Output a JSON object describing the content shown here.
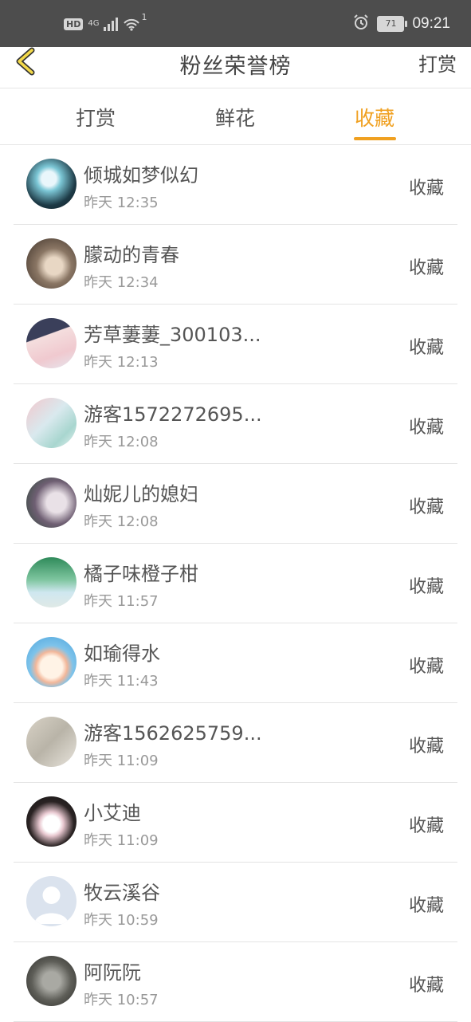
{
  "status_bar": {
    "hd": "HD",
    "network": "4G",
    "wifi_count": "1",
    "battery": "71",
    "time": "09:21"
  },
  "nav": {
    "title": "粉丝荣誉榜",
    "right_action": "打赏"
  },
  "tabs": [
    {
      "label": "打赏",
      "active": false
    },
    {
      "label": "鲜花",
      "active": false
    },
    {
      "label": "收藏",
      "active": true
    }
  ],
  "colors": {
    "accent": "#f0a020",
    "status_bar": "#4d4d4d",
    "text_primary": "#555555",
    "text_secondary": "#999999"
  },
  "rows": [
    {
      "name": "倾城如梦似幻",
      "time": "昨天 12:35",
      "action": "收藏"
    },
    {
      "name": "朦动的青春",
      "time": "昨天 12:34",
      "action": "收藏"
    },
    {
      "name": "芳草萋萋_300103...",
      "time": "昨天 12:13",
      "action": "收藏"
    },
    {
      "name": "游客1572272695...",
      "time": "昨天 12:08",
      "action": "收藏"
    },
    {
      "name": "灿妮儿的媳妇",
      "time": "昨天 12:08",
      "action": "收藏"
    },
    {
      "name": "橘子味橙子柑",
      "time": "昨天 11:57",
      "action": "收藏"
    },
    {
      "name": "如瑜得水",
      "time": "昨天 11:43",
      "action": "收藏"
    },
    {
      "name": "游客1562625759...",
      "time": "昨天 11:09",
      "action": "收藏"
    },
    {
      "name": "小艾迪",
      "time": "昨天 11:09",
      "action": "收藏"
    },
    {
      "name": "牧云溪谷",
      "time": "昨天 10:59",
      "action": "收藏"
    },
    {
      "name": "阿阮阮",
      "time": "昨天 10:57",
      "action": "收藏"
    }
  ]
}
